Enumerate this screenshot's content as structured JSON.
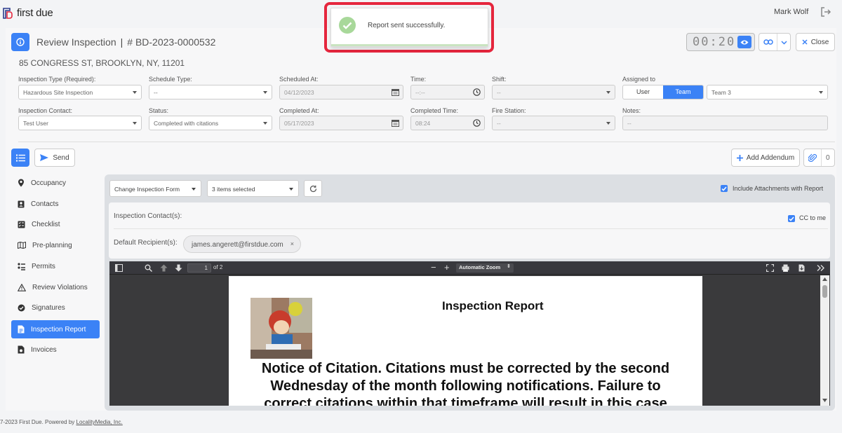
{
  "app": {
    "logo_text": "first due",
    "user_name": "Mark Wolf"
  },
  "header": {
    "title": "Review Inspection",
    "inspection_id": "# BD-2023-0000532",
    "address": "85 CONGRESS ST, BROOKLYN, NY, 11201",
    "timer": "00:20",
    "close_label": "Close"
  },
  "form": {
    "inspection_type": {
      "label": "Inspection Type (Required):",
      "value": "Hazardous Site Inspection"
    },
    "schedule_type": {
      "label": "Schedule Type:",
      "value": "--"
    },
    "scheduled_at": {
      "label": "Scheduled At:",
      "value": "04/12/2023"
    },
    "time": {
      "label": "Time:",
      "value": "--:--"
    },
    "shift": {
      "label": "Shift:",
      "value": "--"
    },
    "assigned_to": {
      "label": "Assigned to",
      "options": [
        "User",
        "Team"
      ],
      "selected": "Team",
      "team_value": "Team 3"
    },
    "inspection_contact": {
      "label": "Inspection Contact:",
      "value": "Test User"
    },
    "status": {
      "label": "Status:",
      "value": "Completed with citations"
    },
    "completed_at": {
      "label": "Completed At:",
      "value": "05/17/2023"
    },
    "completed_time": {
      "label": "Completed Time:",
      "value": "08:24"
    },
    "fire_station": {
      "label": "Fire Station:",
      "value": "--"
    },
    "notes": {
      "label": "Notes:",
      "value": "--"
    }
  },
  "actions": {
    "send_label": "Send",
    "add_addendum_label": "Add Addendum",
    "attachment_count": "0"
  },
  "sidebar": {
    "items": [
      {
        "label": "Occupancy",
        "icon": "map-pin-icon"
      },
      {
        "label": "Contacts",
        "icon": "contact-card-icon"
      },
      {
        "label": "Checklist",
        "icon": "checklist-icon"
      },
      {
        "label": "Pre-planning",
        "icon": "map-icon"
      },
      {
        "label": "Permits",
        "icon": "permits-icon"
      },
      {
        "label": "Review Violations",
        "icon": "warning-icon"
      },
      {
        "label": "Signatures",
        "icon": "check-circle-icon"
      },
      {
        "label": "Inspection Report",
        "icon": "report-icon",
        "active": true
      },
      {
        "label": "Invoices",
        "icon": "invoice-icon"
      }
    ]
  },
  "report": {
    "change_form_label": "Change Inspection Form",
    "items_selected": "3 items selected",
    "include_attachments_label": "Include Attachments with Report",
    "include_attachments_checked": true,
    "inspection_contacts_label": "Inspection Contact(s):",
    "cc_to_me_label": "CC to me",
    "cc_to_me_checked": true,
    "default_recipients_label": "Default Recipient(s):",
    "recipient_email": "james.angerett@firstdue.com",
    "chip_remove": "×"
  },
  "pdf": {
    "page_number": "1",
    "page_of": "of 2",
    "zoom": "Automatic Zoom",
    "zoom_minus": "−",
    "zoom_plus": "+",
    "page_title": "Inspection Report",
    "notice_text": "Notice of Citation. Citations must be corrected by the second Wednesday of the month following notifications. Failure to correct citations within that timeframe will result in this case"
  },
  "toast": {
    "message": "Report sent successfully."
  },
  "footer": {
    "text": "7-2023 First Due. Powered by ",
    "link": "LocalityMedia, Inc."
  },
  "colors": {
    "accent": "#3b82f6",
    "toast_outline": "#e5263d",
    "success": "#a8d89a"
  }
}
